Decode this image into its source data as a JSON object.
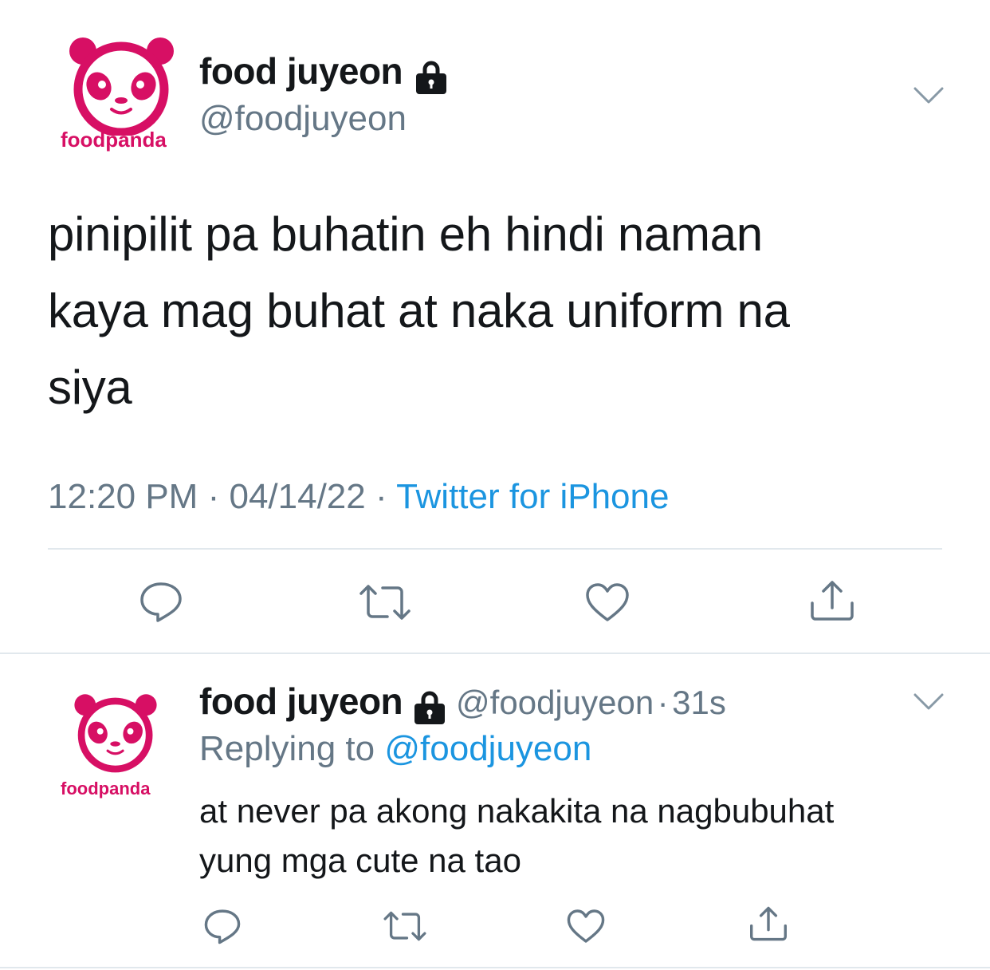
{
  "colors": {
    "brand": "#d70f64",
    "link": "#1b95e0",
    "muted": "#657786",
    "text": "#14171a",
    "divider": "#e1e8ed"
  },
  "main_tweet": {
    "avatar_logo_text": "foodpanda",
    "display_name": "food juyeon",
    "handle": "@foodjuyeon",
    "text_lines": [
      "pinipilit pa buhatin eh hindi naman",
      "kaya mag buhat at naka uniform na",
      "siya"
    ],
    "time": "12:20 PM",
    "date": "04/14/22",
    "source": "Twitter for iPhone",
    "separator": "·",
    "icons": [
      "reply-icon",
      "retweet-icon",
      "like-icon",
      "share-icon"
    ]
  },
  "reply_tweet": {
    "avatar_logo_text": "foodpanda",
    "display_name": "food juyeon",
    "handle": "@foodjuyeon",
    "separator": "·",
    "age": "31s",
    "replying_to_label": "Replying to",
    "replying_to_handle": "@foodjuyeon",
    "text_lines": [
      "at never pa akong nakakita na nagbubuhat",
      "yung mga cute na tao"
    ]
  }
}
